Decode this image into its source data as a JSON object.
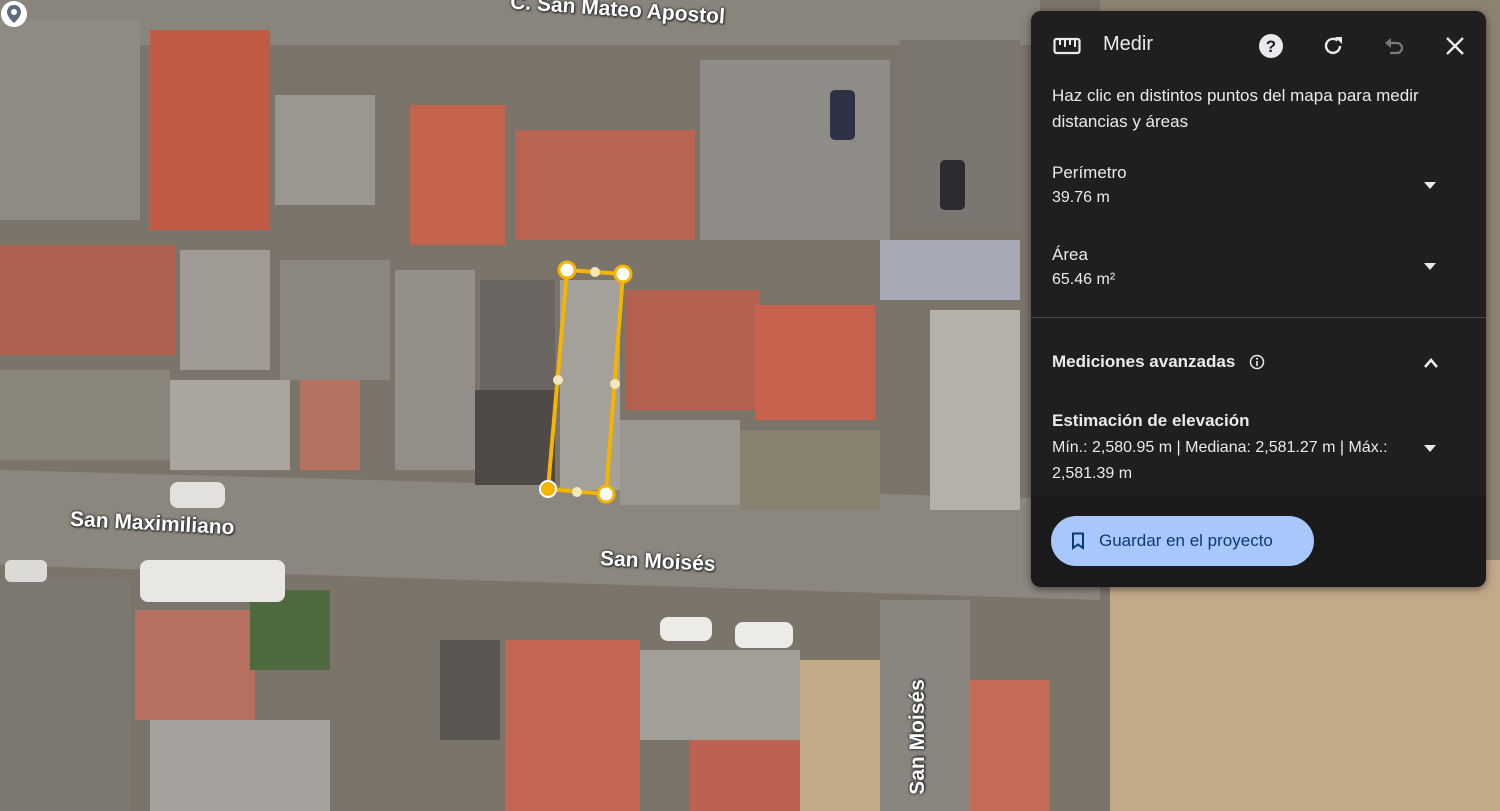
{
  "map": {
    "streets": {
      "top": "C. San Mateo Apostol",
      "left": "San Maximiliano",
      "center": "San Moisés",
      "vertical": "San Moisés"
    },
    "measure_color": "#f4b400"
  },
  "panel": {
    "title": "Medir",
    "title_icon": "ruler-icon",
    "header_buttons": [
      "help-icon",
      "refresh-icon",
      "undo-icon",
      "close-icon"
    ],
    "intro": "Haz clic en distintos puntos del mapa para medir distancias y áreas",
    "perimeter": {
      "label": "Perímetro",
      "value": "39.76 m"
    },
    "area": {
      "label": "Área",
      "value": "65.46 m²"
    },
    "advanced": {
      "label": "Mediciones avanzadas"
    },
    "elevation": {
      "label": "Estimación de elevación",
      "value": "Mín.: 2,580.95 m | Mediana: 2,581.27 m | Máx.: 2,581.39 m"
    },
    "save_label": "Guardar en el proyecto"
  },
  "colors": {
    "panel_bg": "#1f1f1f",
    "button_bg": "#a8c7fa",
    "button_text": "#0b3a77"
  }
}
